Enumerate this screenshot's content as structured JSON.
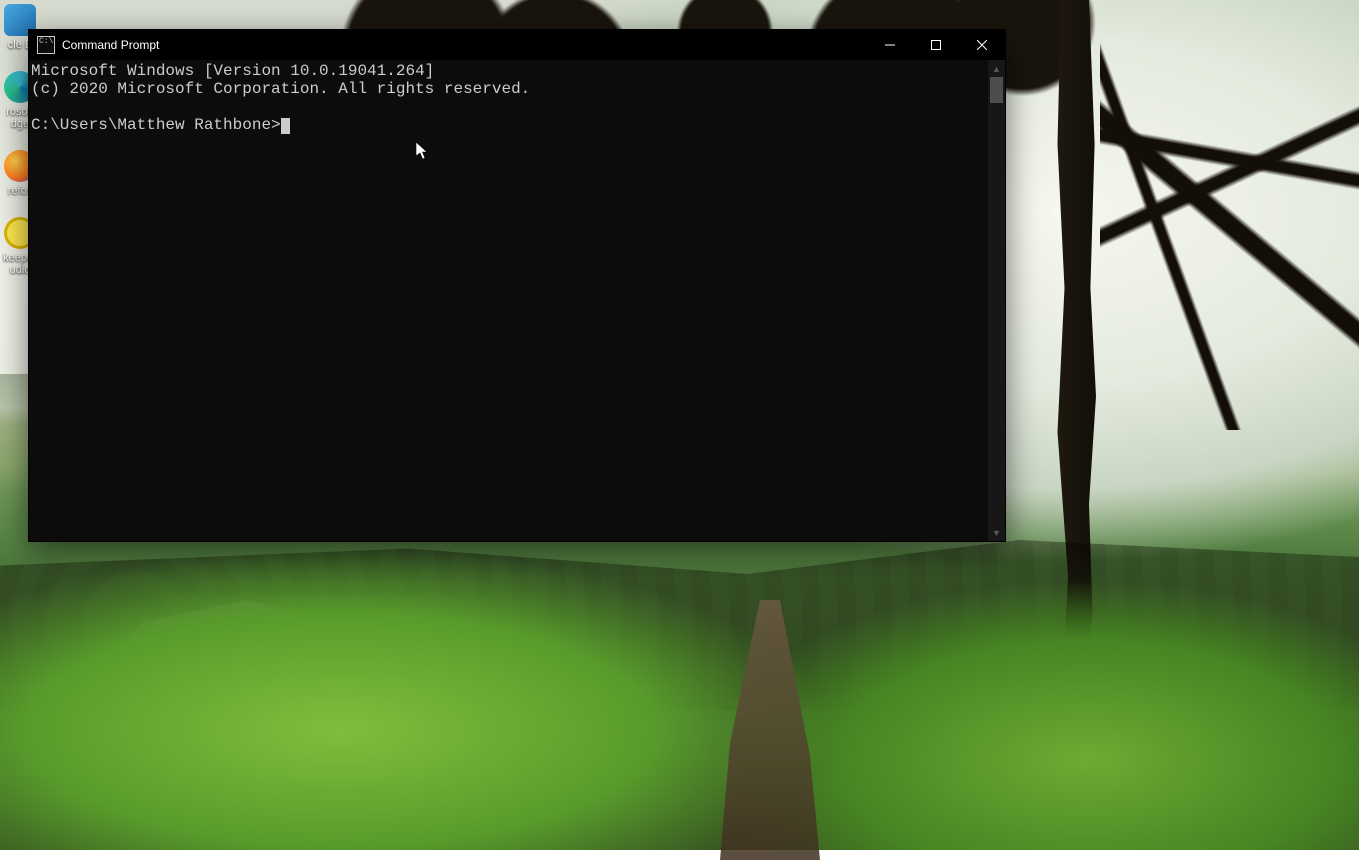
{
  "desktop": {
    "icons": [
      {
        "name": "recycle-bin",
        "label": "cle B",
        "icon_class": "recycle"
      },
      {
        "name": "microsoft-edge",
        "label": "rosoft dge",
        "icon_class": "edge"
      },
      {
        "name": "firefox",
        "label": "refox",
        "icon_class": "firefox"
      },
      {
        "name": "beekeeper-studio",
        "label": "keeper udio",
        "icon_class": "beekeeper"
      }
    ]
  },
  "window": {
    "title": "Command Prompt",
    "controls": {
      "minimize": "Minimize",
      "maximize": "Maximize",
      "close": "Close"
    }
  },
  "terminal": {
    "line1": "Microsoft Windows [Version 10.0.19041.264]",
    "line2": "(c) 2020 Microsoft Corporation. All rights reserved.",
    "blank": "",
    "prompt": "C:\\Users\\Matthew Rathbone>"
  },
  "scrollbar": {
    "up": "▲",
    "down": "▼"
  }
}
